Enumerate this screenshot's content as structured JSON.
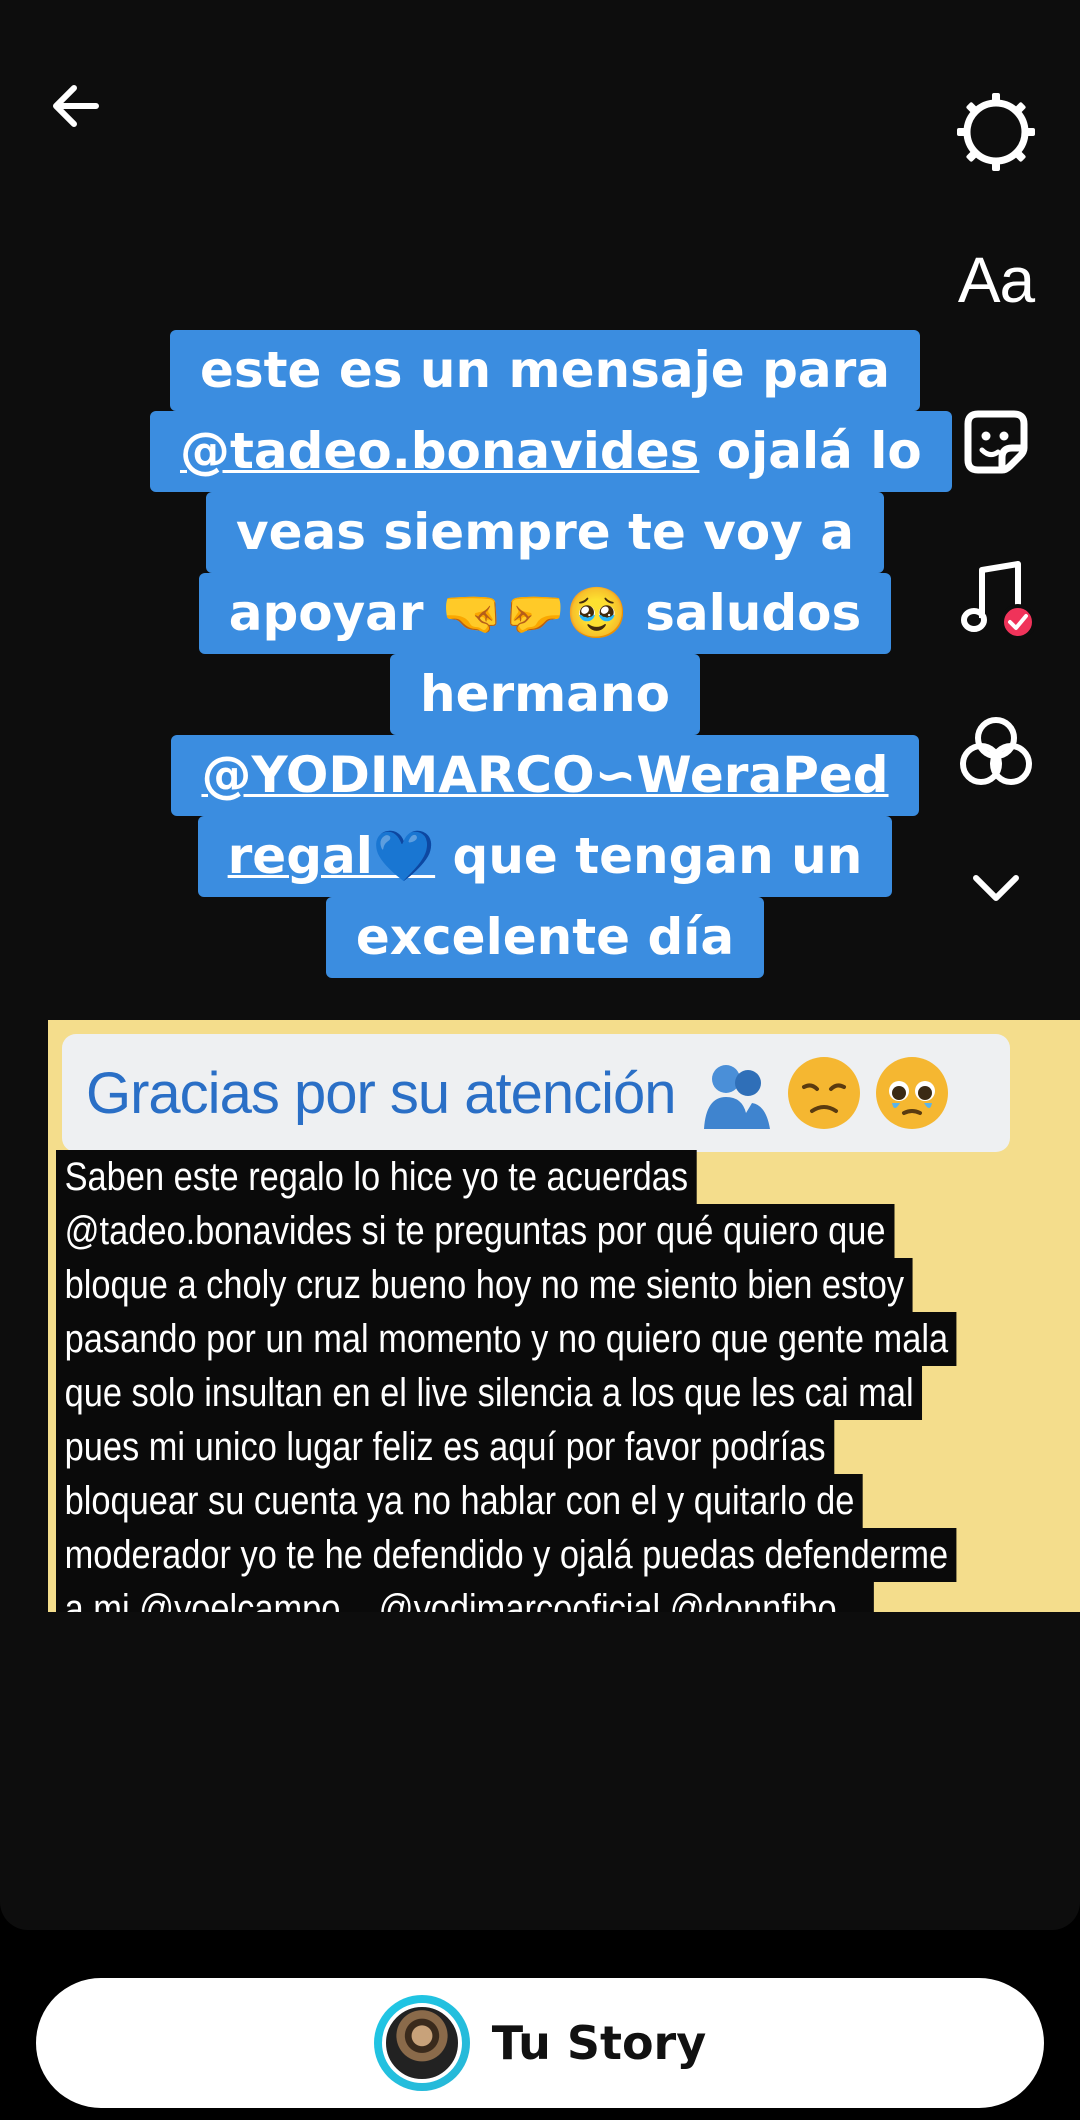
{
  "toolbar": {
    "back_icon": "arrow-left-icon",
    "settings_icon": "gear-icon",
    "text_label": "Aa",
    "sticker_icon": "sticker-icon",
    "music_icon": "music-note-icon",
    "effects_icon": "effects-icon",
    "more_icon": "chevron-down-icon"
  },
  "caption": {
    "lines": [
      "este es un mensaje para",
      "@tadeo.bonavides ojalá lo",
      "veas siempre te voy a",
      "apoyar 🤜🤛🥹 saludos",
      "hermano",
      "@YODIMARCO∽WeraPed",
      "regal💙 que tengan un",
      "excelente día"
    ],
    "mention_1": "@tadeo.bonavides",
    "mention_1_rest": " ojalá lo",
    "mention_2": "@YODIMARCO∽WeraPed",
    "mention_2b": "regal💙",
    "mention_2b_rest": " que tengan un",
    "color": "#3b8de0"
  },
  "card": {
    "title": "Gracias por su atención",
    "title_emojis": [
      "🫂",
      "😞",
      "🥹"
    ],
    "body_lines": [
      "Saben este regalo lo hice yo te acuerdas",
      "@tadeo.bonavides si te preguntas por qué quiero que",
      "bloque a choly cruz bueno hoy no me siento bien estoy",
      "pasando por un mal momento y no quiero que gente mala",
      "que solo insultan en el live silencia a los que les cai mal",
      "pues mi unico lugar feliz es aquí por favor podrías",
      "bloquear su cuenta ya no hablar con el y quitarlo de",
      "moderador yo te he defendido y ojalá puedas defenderme",
      "a mi @yoelcampo... @yodimarcooficial @donnfibo..."
    ],
    "background_color": "#f4dd8c"
  },
  "story": {
    "label": "Tu Story",
    "avatar_icon": "avatar"
  }
}
